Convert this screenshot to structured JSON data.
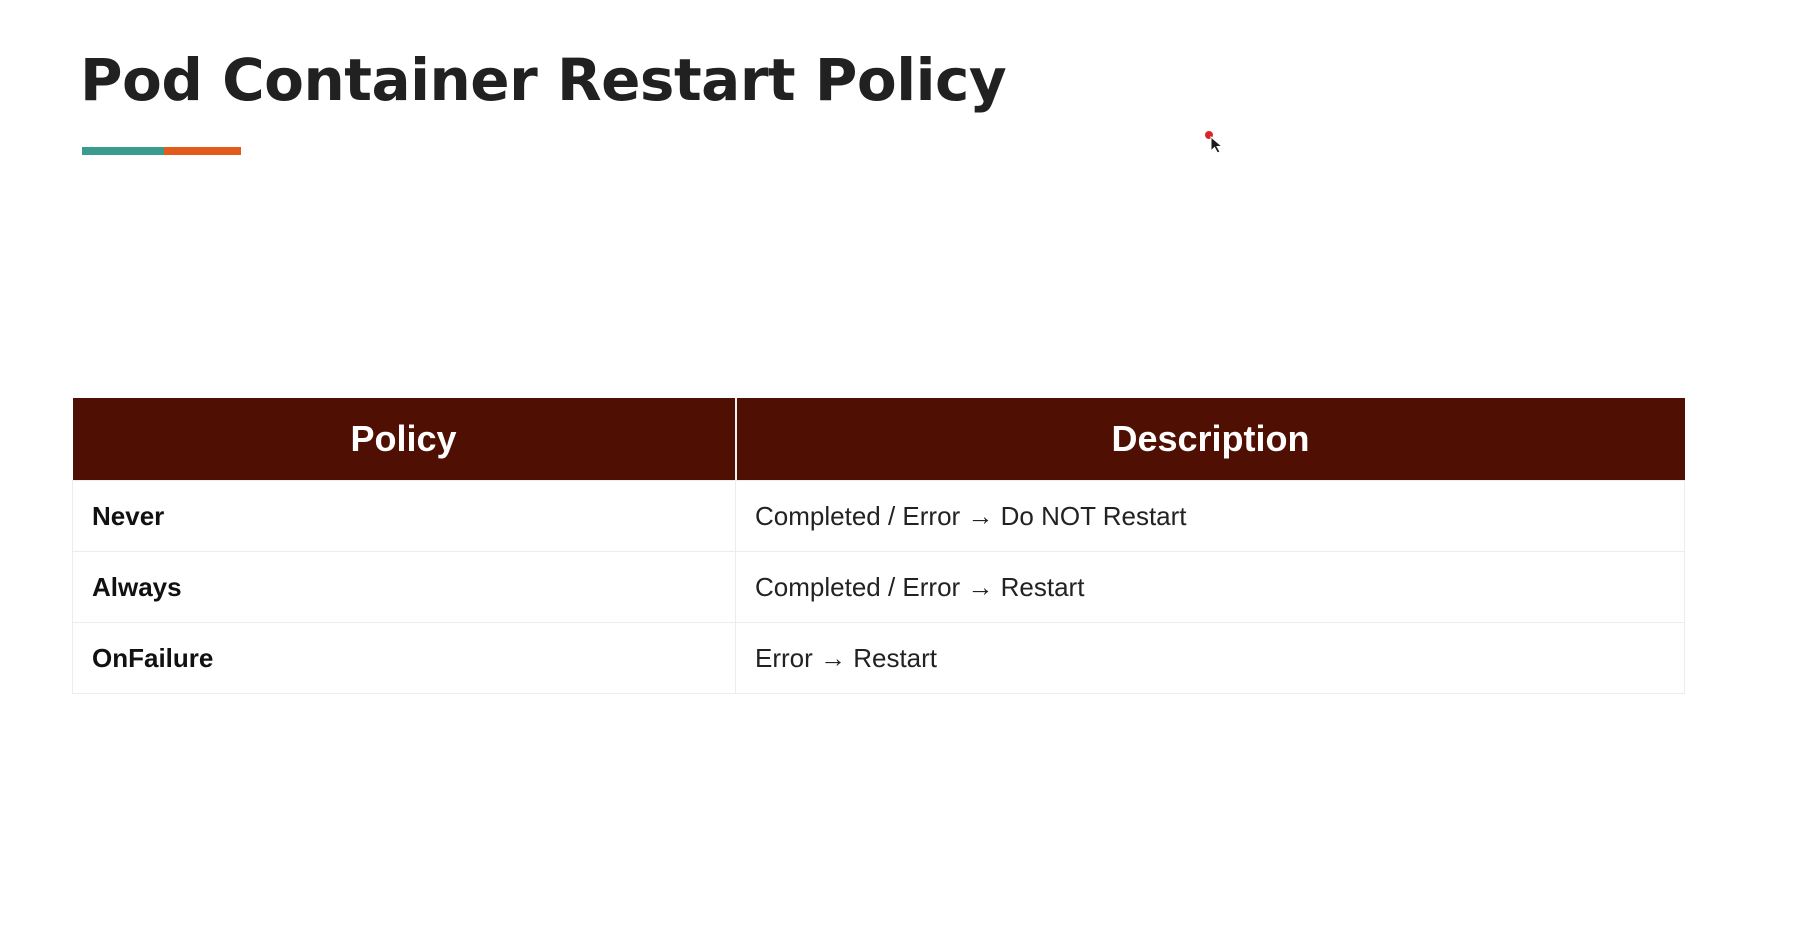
{
  "slide": {
    "title": "Pod Container Restart Policy"
  },
  "colors": {
    "accent_teal": "#3a9b8f",
    "accent_orange": "#e25a1c",
    "header_bg": "#4f0f03",
    "cursor_dot": "#d9262b"
  },
  "table": {
    "headers": [
      "Policy",
      "Description"
    ],
    "rows": [
      {
        "policy": "Never",
        "description": "Completed / Error → Do NOT Restart"
      },
      {
        "policy": "Always",
        "description": "Completed / Error → Restart"
      },
      {
        "policy": "OnFailure",
        "description": "Error → Restart"
      }
    ]
  },
  "icons": {
    "cursor": "mouse-pointer-icon"
  }
}
